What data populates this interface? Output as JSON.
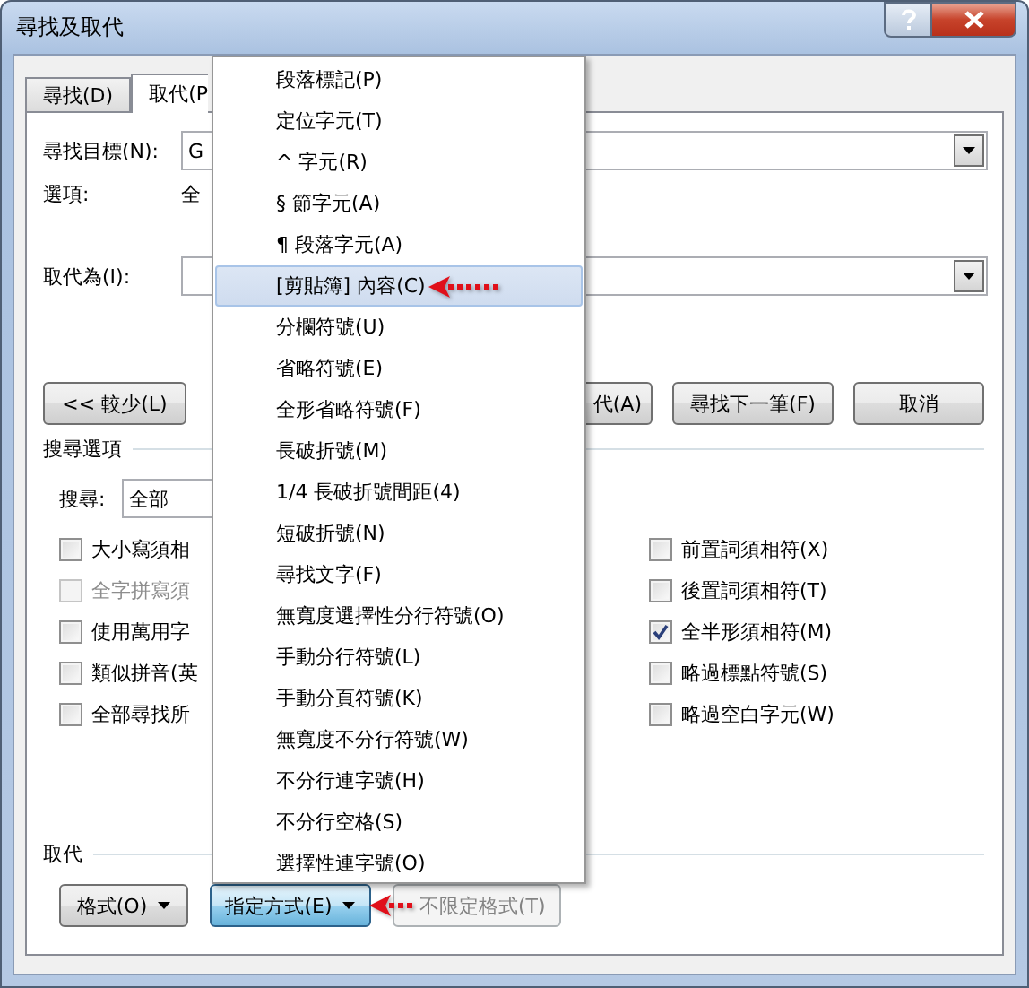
{
  "window": {
    "title": "尋找及取代"
  },
  "tabs": [
    {
      "label": "尋找(D)",
      "selected": false
    },
    {
      "label": "取代(P",
      "selected": true
    }
  ],
  "find": {
    "label": "尋找目標(N):",
    "value": "G"
  },
  "options": {
    "label": "選項:",
    "value": "全"
  },
  "replace": {
    "label": "取代為(I):"
  },
  "buttons": [
    "<< 較少(L)",
    "代(A)",
    "尋找下一筆(F)",
    "取消"
  ],
  "search_options": {
    "title": "搜尋選項",
    "search_label": "搜尋:",
    "search_value": "全部",
    "left": [
      {
        "label": "大小寫須相",
        "checked": false,
        "disabled": false
      },
      {
        "label": "全字拼寫須",
        "checked": false,
        "disabled": true
      },
      {
        "label": "使用萬用字",
        "checked": false,
        "disabled": false
      },
      {
        "label": "類似拼音(英",
        "checked": false,
        "disabled": false
      },
      {
        "label": "全部尋找所",
        "checked": false,
        "disabled": false
      }
    ],
    "right": [
      {
        "label": "前置詞須相符(X)",
        "checked": false,
        "disabled": false
      },
      {
        "label": "後置詞須相符(T)",
        "checked": false,
        "disabled": false
      },
      {
        "label": "全半形須相符(M)",
        "checked": true,
        "disabled": false
      },
      {
        "label": "略過標點符號(S)",
        "checked": false,
        "disabled": false
      },
      {
        "label": "略過空白字元(W)",
        "checked": false,
        "disabled": false
      }
    ]
  },
  "replace_section": {
    "title": "取代",
    "buttons": [
      {
        "label": "格式(O)",
        "kind": "dropdown",
        "pressed": false,
        "disabled": false,
        "arrow": false
      },
      {
        "label": "指定方式(E)",
        "kind": "dropdown",
        "pressed": true,
        "disabled": false,
        "arrow": true
      },
      {
        "label": "不限定格式(T)",
        "kind": "plain",
        "pressed": false,
        "disabled": true,
        "arrow": false
      }
    ]
  },
  "menu": {
    "items": [
      {
        "label": "段落標記(P)",
        "selected": false,
        "arrow": false
      },
      {
        "label": "定位字元(T)",
        "selected": false,
        "arrow": false
      },
      {
        "label": "^ 字元(R)",
        "selected": false,
        "arrow": false
      },
      {
        "label": "§ 節字元(A)",
        "selected": false,
        "arrow": false
      },
      {
        "label": "¶ 段落字元(A)",
        "selected": false,
        "arrow": false
      },
      {
        "label": "[剪貼簿] 內容(C)",
        "selected": true,
        "arrow": true
      },
      {
        "label": "分欄符號(U)",
        "selected": false,
        "arrow": false
      },
      {
        "label": "省略符號(E)",
        "selected": false,
        "arrow": false
      },
      {
        "label": "全形省略符號(F)",
        "selected": false,
        "arrow": false
      },
      {
        "label": "長破折號(M)",
        "selected": false,
        "arrow": false
      },
      {
        "label": "1/4 長破折號間距(4)",
        "selected": false,
        "arrow": false
      },
      {
        "label": "短破折號(N)",
        "selected": false,
        "arrow": false
      },
      {
        "label": "尋找文字(F)",
        "selected": false,
        "arrow": false
      },
      {
        "label": "無寬度選擇性分行符號(O)",
        "selected": false,
        "arrow": false
      },
      {
        "label": "手動分行符號(L)",
        "selected": false,
        "arrow": false
      },
      {
        "label": "手動分頁符號(K)",
        "selected": false,
        "arrow": false
      },
      {
        "label": "無寬度不分行符號(W)",
        "selected": false,
        "arrow": false
      },
      {
        "label": "不分行連字號(H)",
        "selected": false,
        "arrow": false
      },
      {
        "label": "不分行空格(S)",
        "selected": false,
        "arrow": false
      },
      {
        "label": "選擇性連字號(O)",
        "selected": false,
        "arrow": false
      }
    ]
  }
}
